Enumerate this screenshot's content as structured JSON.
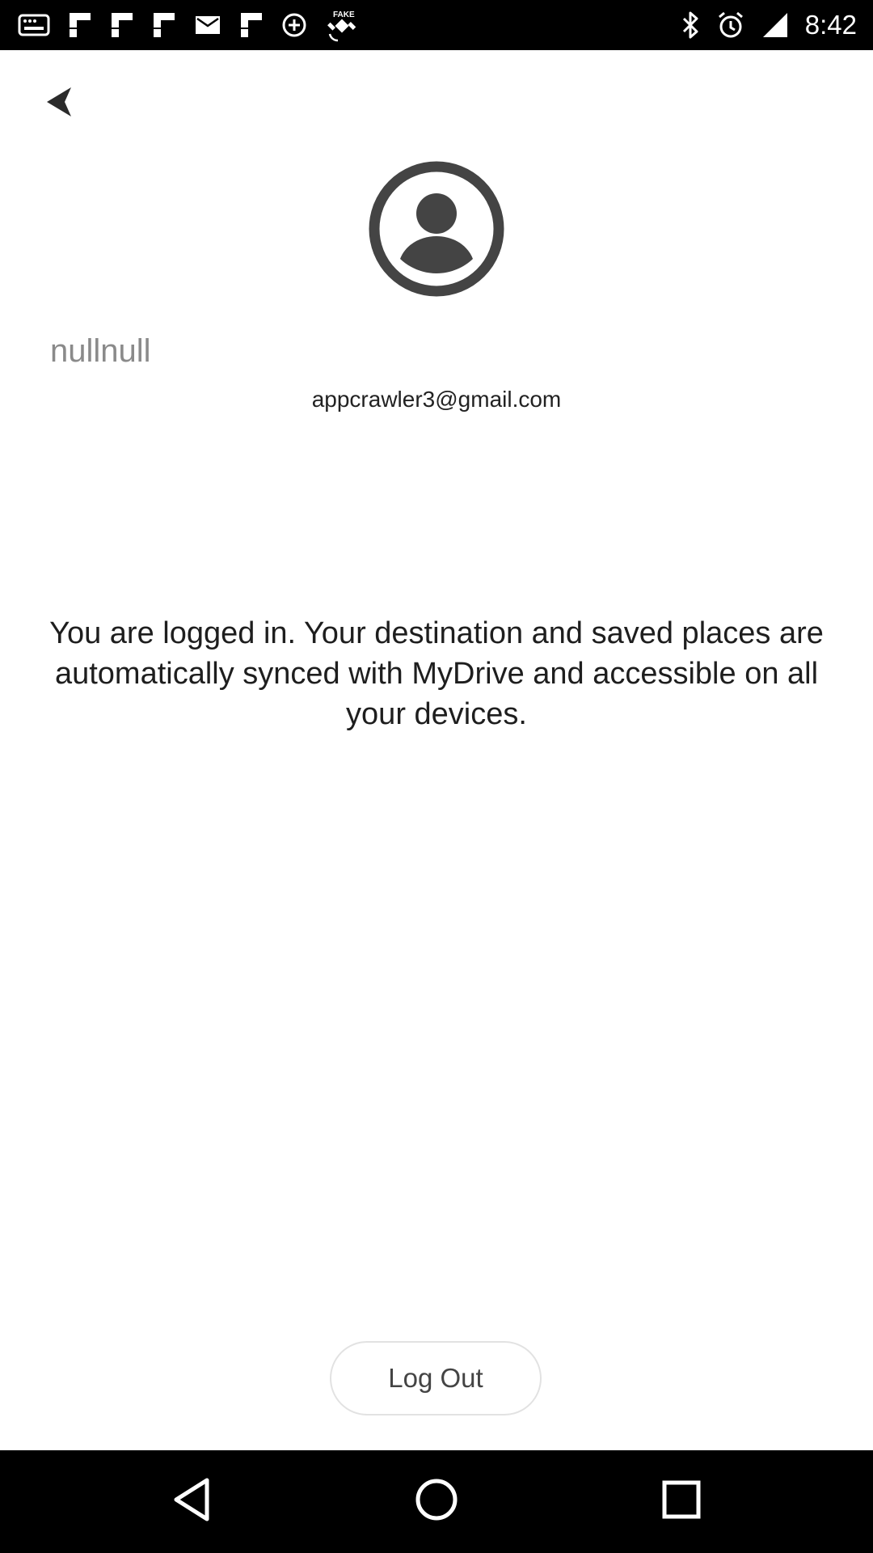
{
  "status_bar": {
    "time": "8:42",
    "left_icons": [
      "screen-mirror-icon",
      "flipboard-icon",
      "flipboard-icon",
      "flipboard-icon",
      "mail-icon",
      "flipboard-icon",
      "data-saver-icon",
      "fake-gps-icon"
    ],
    "right_icons": [
      "bluetooth-icon",
      "alarm-icon",
      "signal-icon"
    ]
  },
  "header": {
    "back_icon": "back-arrow-icon"
  },
  "profile": {
    "avatar_icon": "account-circle-icon",
    "name": "nullnull",
    "email": "appcrawler3@gmail.com"
  },
  "main": {
    "message": "You are logged in. Your destination and saved places are automatically synced with MyDrive and accessible on all your devices."
  },
  "actions": {
    "logout_label": "Log Out"
  },
  "nav_bar": {
    "icons": [
      "nav-back-icon",
      "nav-home-icon",
      "nav-recents-icon"
    ]
  },
  "colors": {
    "background": "#ffffff",
    "status_bar": "#000000",
    "avatar": "#444444",
    "username": "#8a8a8a",
    "text": "#1e1e1e"
  }
}
